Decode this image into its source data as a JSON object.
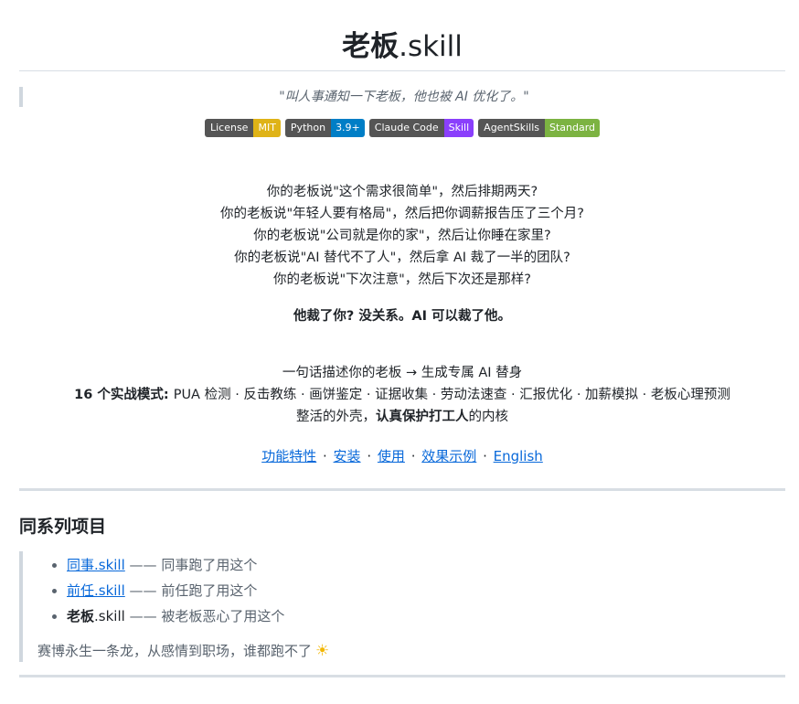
{
  "header": {
    "title_bold": "老板",
    "title_suffix": ".skill",
    "quote": "\"叫人事通知一下老板，他也被 AI 优化了。\""
  },
  "badges": [
    {
      "left": "License",
      "right": "MIT",
      "color": "#dfb317"
    },
    {
      "left": "Python",
      "right": "3.9+",
      "color": "#007ec6"
    },
    {
      "left": "Claude Code",
      "right": "Skill",
      "color": "#8a3ffc"
    },
    {
      "left": "AgentSkills",
      "right": "Standard",
      "color": "#7cb342"
    }
  ],
  "pains": [
    "你的老板说\"这个需求很简单\"，然后排期两天?",
    "你的老板说\"年轻人要有格局\"，然后把你调薪报告压了三个月?",
    "你的老板说\"公司就是你的家\"，然后让你睡在家里?",
    "你的老板说\"AI 替代不了人\"，然后拿 AI 裁了一半的团队?",
    "你的老板说\"下次注意\"，然后下次还是那样?"
  ],
  "punchline": "他裁了你? 没关系。AI 可以裁了他。",
  "description": {
    "line1": "一句话描述你的老板 → 生成专属 AI 替身",
    "modes_label": "16 个实战模式",
    "modes_colon": ": ",
    "modes": "PUA 检测 · 反击教练 · 画饼鉴定 · 证据收集 · 劳动法速查 · 汇报优化 · 加薪模拟 · 老板心理预测",
    "line3_pre": "整活的外壳，",
    "line3_bold": "认真保护打工人",
    "line3_post": "的内核"
  },
  "nav": {
    "features": "功能特性",
    "install": "安装",
    "usage": "使用",
    "examples": "效果示例",
    "english": "English",
    "separator": "·"
  },
  "series": {
    "heading": "同系列项目",
    "items": [
      {
        "link": "同事.skill",
        "desc": " —— 同事跑了用这个"
      },
      {
        "link": "前任.skill",
        "desc": " —— 前任跑了用这个"
      }
    ],
    "current_bold": "老板",
    "current_suffix": ".skill",
    "current_desc": " —— 被老板恶心了用这个",
    "tagline": "赛博永生一条龙，从感情到职场，谁都跑不了",
    "tagline_icon": "sun-icon"
  }
}
